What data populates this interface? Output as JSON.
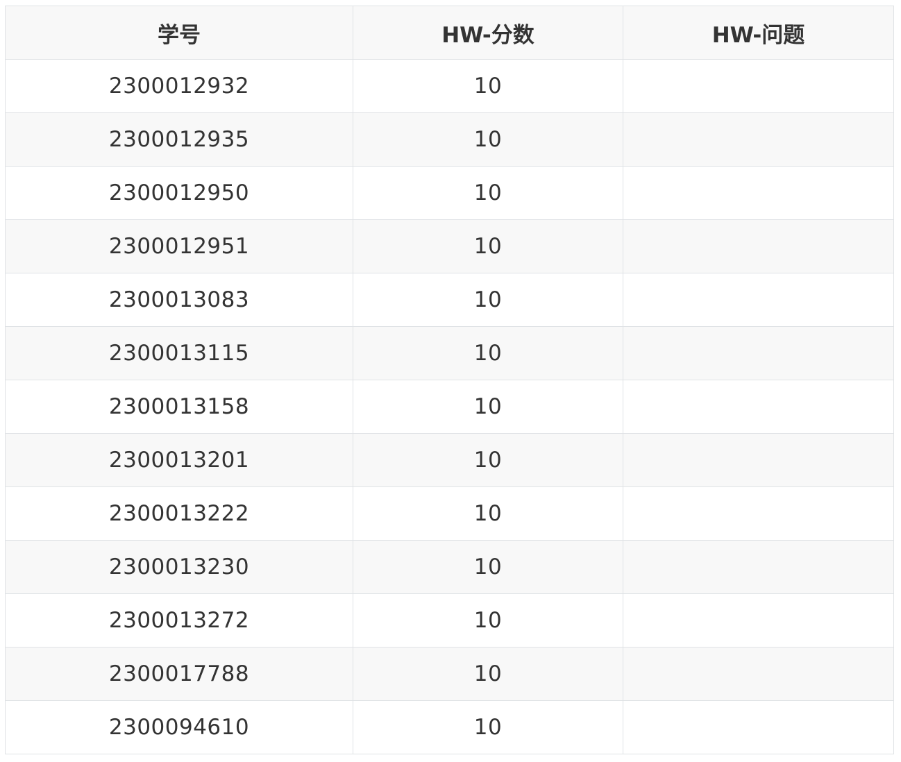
{
  "table": {
    "headers": {
      "student_id": "学号",
      "hw_score": "HW-分数",
      "hw_issue": "HW-问题"
    },
    "rows": [
      {
        "student_id": "2300012932",
        "hw_score": "10",
        "hw_issue": ""
      },
      {
        "student_id": "2300012935",
        "hw_score": "10",
        "hw_issue": ""
      },
      {
        "student_id": "2300012950",
        "hw_score": "10",
        "hw_issue": ""
      },
      {
        "student_id": "2300012951",
        "hw_score": "10",
        "hw_issue": ""
      },
      {
        "student_id": "2300013083",
        "hw_score": "10",
        "hw_issue": ""
      },
      {
        "student_id": "2300013115",
        "hw_score": "10",
        "hw_issue": ""
      },
      {
        "student_id": "2300013158",
        "hw_score": "10",
        "hw_issue": ""
      },
      {
        "student_id": "2300013201",
        "hw_score": "10",
        "hw_issue": ""
      },
      {
        "student_id": "2300013222",
        "hw_score": "10",
        "hw_issue": ""
      },
      {
        "student_id": "2300013230",
        "hw_score": "10",
        "hw_issue": ""
      },
      {
        "student_id": "2300013272",
        "hw_score": "10",
        "hw_issue": ""
      },
      {
        "student_id": "2300017788",
        "hw_score": "10",
        "hw_issue": ""
      },
      {
        "student_id": "2300094610",
        "hw_score": "10",
        "hw_issue": ""
      }
    ]
  },
  "colors": {
    "border": "#dfe2e5",
    "header_bg": "#f8f8f8",
    "stripe_bg": "#f8f8f8",
    "text": "#333333"
  }
}
